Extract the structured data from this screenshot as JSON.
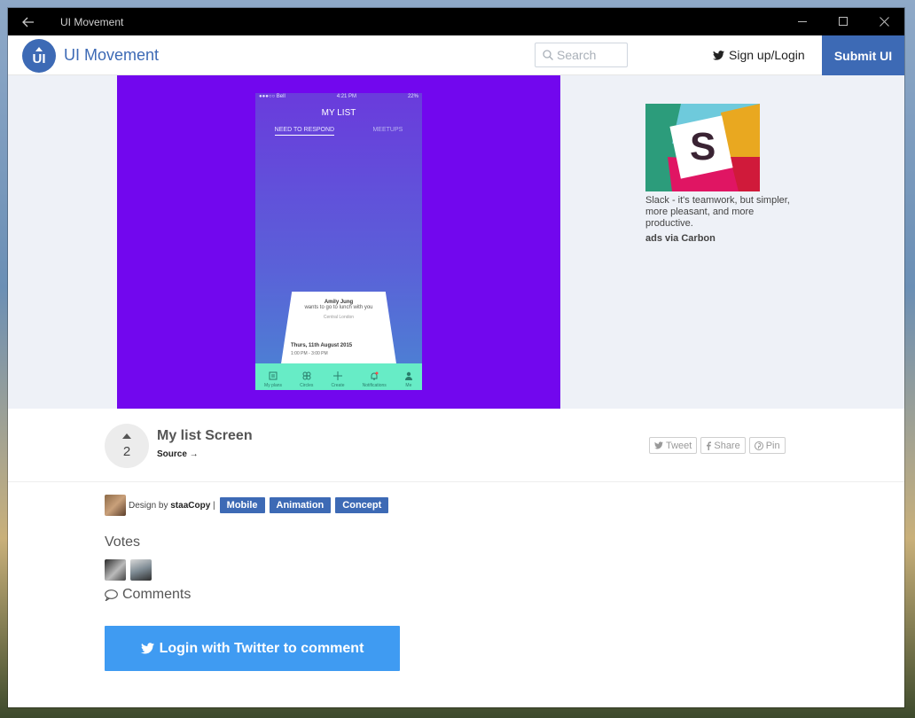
{
  "window": {
    "title": "UI Movement"
  },
  "header": {
    "logo_text": "UI",
    "brand": "UI Movement",
    "search_placeholder": "Search",
    "signup_label": "Sign up/Login",
    "submit_label": "Submit UI"
  },
  "phone_mockup": {
    "status_left": "●●●○○ Bell",
    "status_time": "4:21 PM",
    "status_right": "22%",
    "title": "MY LIST",
    "tabs": [
      "NEED TO RESPOND",
      "MEETUPS"
    ],
    "card": {
      "who": "Amily Jung",
      "message": "wants to go to lunch with you",
      "place": "Central London",
      "date": "Thurs, 11th August 2015",
      "time": "1:00 PM - 3:00 PM"
    },
    "nav": [
      "My plans",
      "Circles",
      "Create",
      "Notifications",
      "Me"
    ]
  },
  "ad": {
    "text": "Slack - it's teamwork, but simpler, more pleasant, and more productive.",
    "via": "ads via Carbon",
    "logo_letter": "S"
  },
  "post": {
    "vote_count": "2",
    "title": "My list Screen",
    "source_label": "Source →",
    "share_buttons": [
      "Tweet",
      "Share",
      "Pin"
    ]
  },
  "meta": {
    "design_prefix": "Design by",
    "designer": "staaCopy",
    "separator": "|",
    "tags": [
      "Mobile",
      "Animation",
      "Concept"
    ]
  },
  "votes_heading": "Votes",
  "comments_heading": "Comments",
  "login_twitter_label": "Login with Twitter to comment",
  "colors": {
    "brand": "#3d6ab5",
    "twitter_button": "#3f9bf2",
    "hero_bg": "#7207ee",
    "phone_nav": "#67ecc6"
  }
}
